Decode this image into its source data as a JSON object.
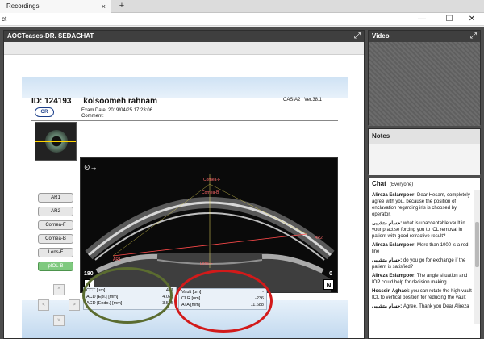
{
  "browser": {
    "tab_label": "Recordings",
    "tab_close": "×",
    "new_tab": "+"
  },
  "window": {
    "title": "ct",
    "minimize": "—",
    "maximize": "☐",
    "close": "✕"
  },
  "left_panel": {
    "title": "AOCTcases-DR. SEDAGHAT",
    "expand": "⤢"
  },
  "slide": {
    "id_label": "ID: 124193",
    "patient_name": "kolsoomeh rahnam",
    "model": "CASIA2",
    "version": "Ver.38.1",
    "logo": "OR",
    "exam_date": "Exam Date: 2019/04/25 17:23:06",
    "comment_label": "Comment:",
    "side_buttons": [
      "AR1",
      "AR2",
      "Cornea-F",
      "Cornea-B",
      "Lens-F",
      "pIOL-B"
    ],
    "dpad": [
      "^",
      "<",
      ">",
      "v"
    ],
    "oct": {
      "label_cornea_f": "Cornea-F",
      "label_cornea_b": "Cornea-B",
      "label_ar1": "AR1",
      "label_ar2": "AR2",
      "label_lens_f": "Lens-F",
      "angle_left": "180",
      "angle_right": "0",
      "badge_left": "T",
      "badge_right": "N",
      "eye_icon": "⊙→"
    },
    "measurements_left": [
      {
        "label": "CCT [um]",
        "value": "401"
      },
      {
        "label": "ACD [Epi.] [mm]",
        "value": "4.026"
      },
      {
        "label": "ACD [Endo.] [mm]",
        "value": "3.565"
      }
    ],
    "measurements_right": [
      {
        "label": "Vault [um]",
        "value": "-"
      },
      {
        "label": "CLR [um]",
        "value": "-236"
      },
      {
        "label": "ATA [mm]",
        "value": "11.688"
      }
    ]
  },
  "video_panel": {
    "title": "Video",
    "expand": "⤢"
  },
  "notes_panel": {
    "title": "Notes"
  },
  "chat_panel": {
    "title": "Chat",
    "scope": "(Everyone)",
    "messages": [
      {
        "author": "Alireza Eslampoor:",
        "text": "Dear Hesam, completely agree with you, because the position of enclavation regarding iris is choosed by operator."
      },
      {
        "author": "حسام متشیبی:",
        "text": "what is unacceptable vault in your practise forcing you to ICL removal in patient with good refractive result?"
      },
      {
        "author": "Alireza Eslampoor:",
        "text": "More than 1000 is a red line"
      },
      {
        "author": "حسام متشیبی:",
        "text": "do you go for exchange if the patient is  satisfied?"
      },
      {
        "author": "Alireza Eslampoor:",
        "text": "The angle situation and IOP could help for decision making."
      },
      {
        "author": "Hossein Aghaei:",
        "text": "you can rotate the high vault ICL to vertical position for reducing the vault"
      },
      {
        "author": "حسام متشیبی:",
        "text": "Agree. Thank you Dear Alireza"
      }
    ]
  }
}
